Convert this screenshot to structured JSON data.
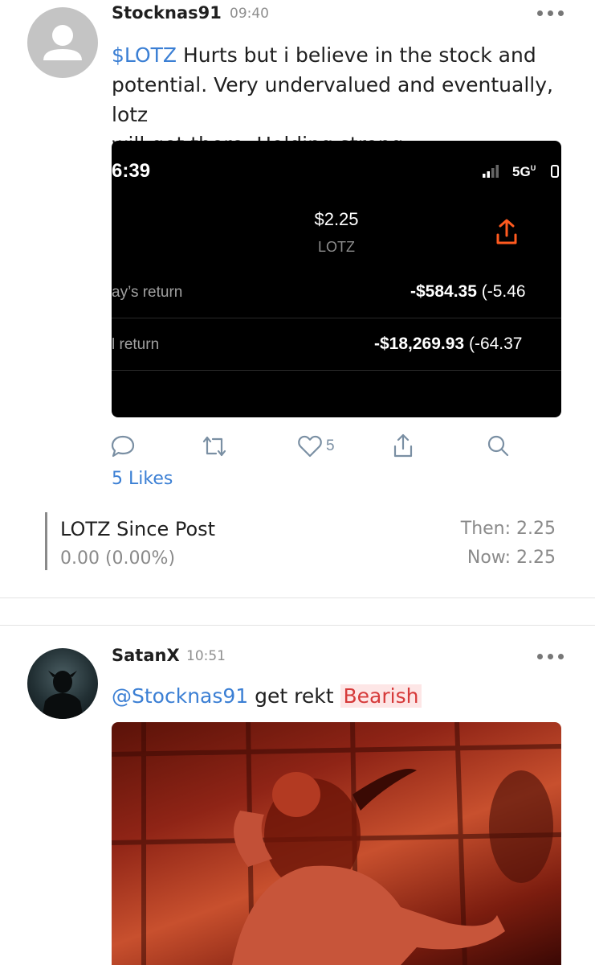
{
  "post1": {
    "username": "Stocknas91",
    "time": "09:40",
    "ticker": "$LOTZ",
    "text_line1": " Hurts but i believe in the stock and",
    "text_line2": "potential. Very undervalued and eventually, lotz",
    "text_line3": "will get there.  Holding strong",
    "screenshot": {
      "clock": "6:39",
      "network": "5G",
      "price": "$2.25",
      "symbol": "LOTZ",
      "row1_label": "ay’s return",
      "row1_value": "-$584.35",
      "row1_pct": "(-5.46",
      "row2_label": "l return",
      "row2_value": "-$18,269.93",
      "row2_pct": "(-64.37",
      "accent": "#ff5a1f"
    },
    "like_count": "5",
    "likes_label": "5 Likes",
    "since": {
      "title": "LOTZ Since Post",
      "change": "0.00 (0.00%)",
      "then": "Then: 2.25",
      "now": "Now: 2.25"
    }
  },
  "post2": {
    "username": "SatanX",
    "time": "10:51",
    "mention": "@Stocknas91",
    "text": " get rekt ",
    "sentiment": "Bearish"
  },
  "colors": {
    "link": "#3b7fd4",
    "bearish": "#d63a3a",
    "bearish_bg": "#fde6e6"
  }
}
